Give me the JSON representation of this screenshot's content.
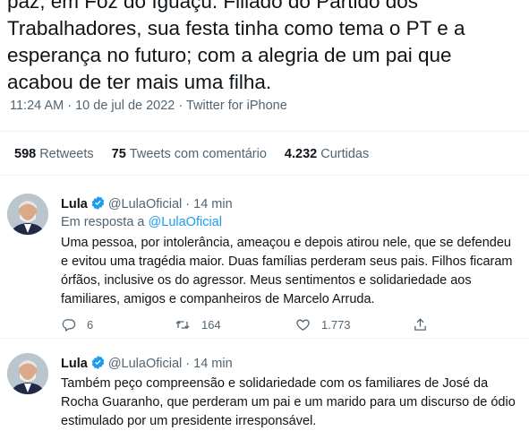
{
  "tweet": {
    "text_lines": [
      "paz, em Foz do Iguaçu. Filiado do Partido dos",
      "Trabalhadores, sua festa tinha como tema o PT e a",
      "esperança no futuro; com a alegria de um pai que",
      "acabou de ter mais uma filha."
    ],
    "time": "11:24 AM",
    "separator": " · ",
    "date": "10 de jul de 2022",
    "source": "Twitter for iPhone",
    "stats": {
      "retweets_count": "598",
      "retweets_label": "Retweets",
      "quotes_count": "75",
      "quotes_label": "Tweets com comentário",
      "likes_count": "4.232",
      "likes_label": "Curtidas"
    }
  },
  "replies": [
    {
      "name": "Lula",
      "handle": "@LulaOficial",
      "time": "14 min",
      "reply_prefix": "Em resposta a",
      "reply_to": "@LulaOficial",
      "text": "Uma pessoa, por intolerância, ameaçou e depois atirou nele, que se defendeu e evitou uma tragédia maior. Duas famílias perderam seus pais. Filhos ficaram órfãos, inclusive os do agressor. Meus sentimentos e solidariedade aos familiares, amigos e companheiros de Marcelo Arruda.",
      "replies_count": "6",
      "retweets_count": "164",
      "likes_count": "1.773"
    },
    {
      "name": "Lula",
      "handle": "@LulaOficial",
      "time": "14 min",
      "text": "Também peço compreensão e solidariedade com os familiares de José da Rocha Guaranho, que perderam um pai e um marido para um discurso de ódio estimulado por um presidente irresponsável."
    }
  ],
  "dot": "·",
  "colors": {
    "accent": "#1d9bf0",
    "text": "#0f1419",
    "muted": "#536471"
  }
}
